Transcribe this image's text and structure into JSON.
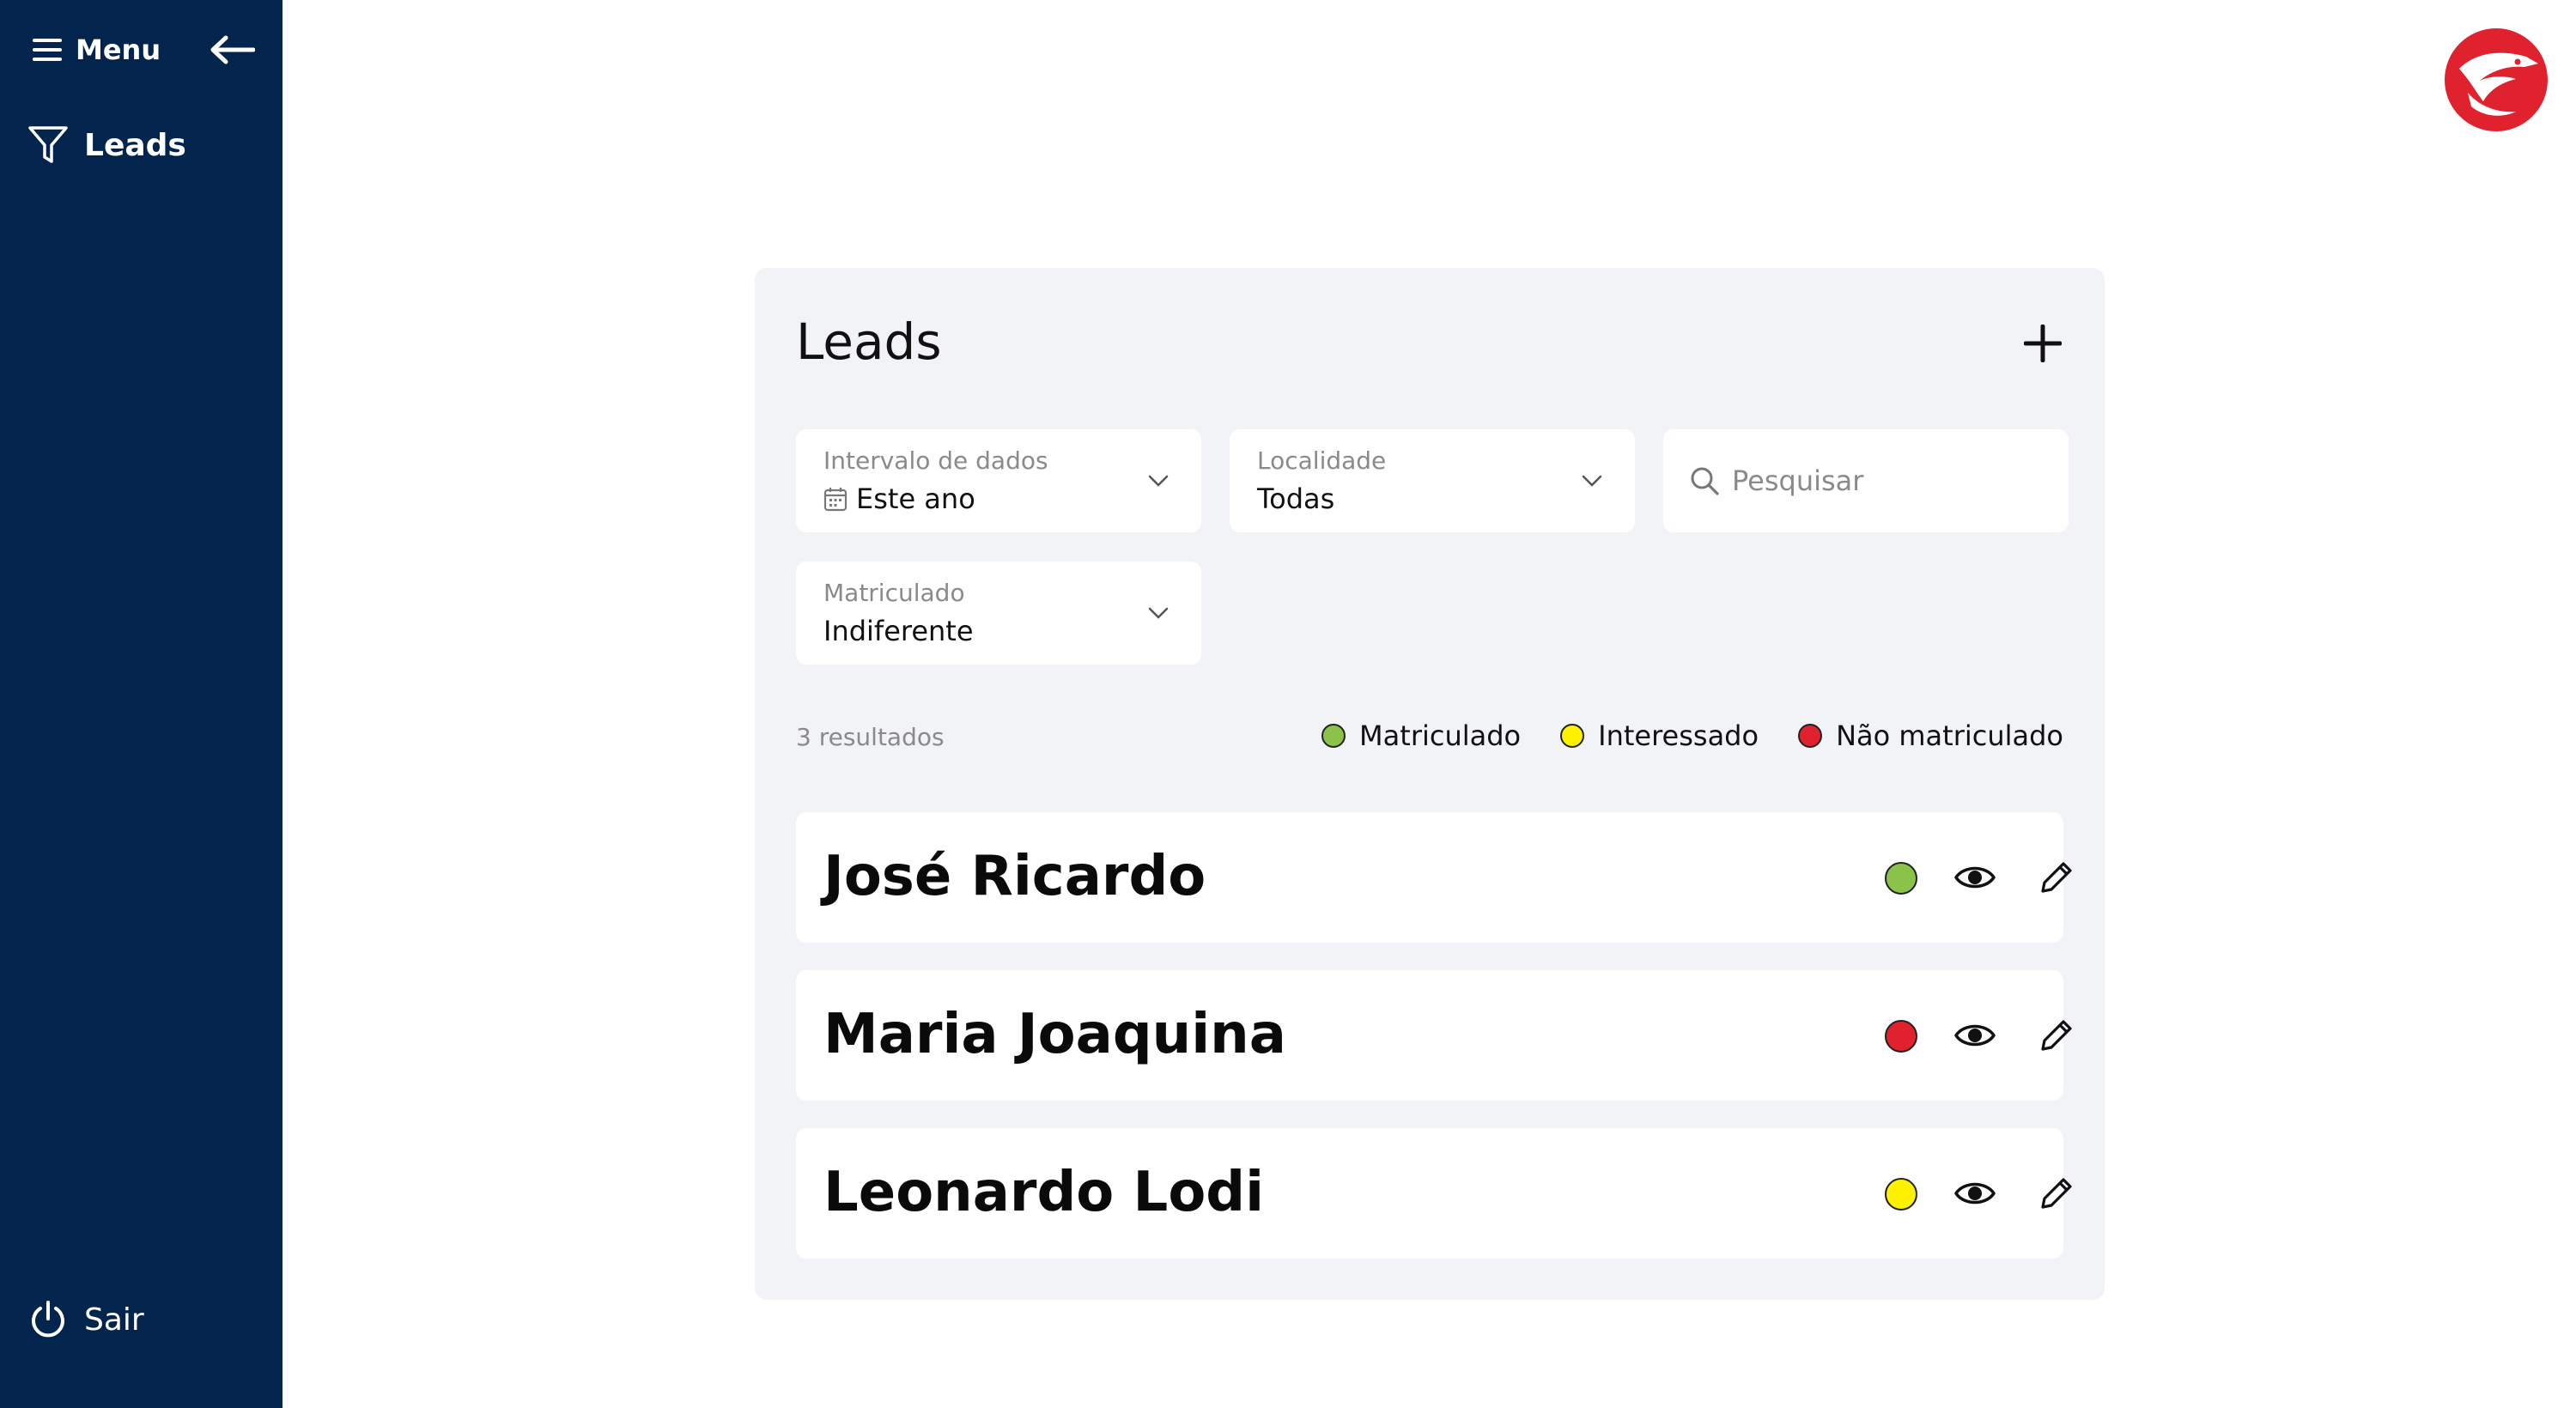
{
  "sidebar": {
    "menu_label": "Menu",
    "nav_leads_label": "Leads",
    "logout_label": "Sair",
    "background": "#03254d"
  },
  "panel": {
    "title": "Leads",
    "add_icon": "plus-icon"
  },
  "filters": {
    "date_range": {
      "label": "Intervalo de dados",
      "value": "Este ano"
    },
    "location": {
      "label": "Localidade",
      "value": "Todas"
    },
    "search": {
      "placeholder": "Pesquisar"
    },
    "enrolled": {
      "label": "Matriculado",
      "value": "Indiferente"
    }
  },
  "results": {
    "count_text": "3 resultados"
  },
  "legend": [
    {
      "label": "Matriculado",
      "color": "#8bc34a"
    },
    {
      "label": "Interessado",
      "color": "#fff200"
    },
    {
      "label": "Não matriculado",
      "color": "#e0212e"
    }
  ],
  "leads": [
    {
      "name": "José Ricardo",
      "status_color": "#8bc34a"
    },
    {
      "name": "Maria Joaquina",
      "status_color": "#e0212e"
    },
    {
      "name": "Leonardo Lodi",
      "status_color": "#fff200"
    }
  ],
  "brand": {
    "logo": "eagle-logo-icon",
    "color": "#e0212e"
  }
}
